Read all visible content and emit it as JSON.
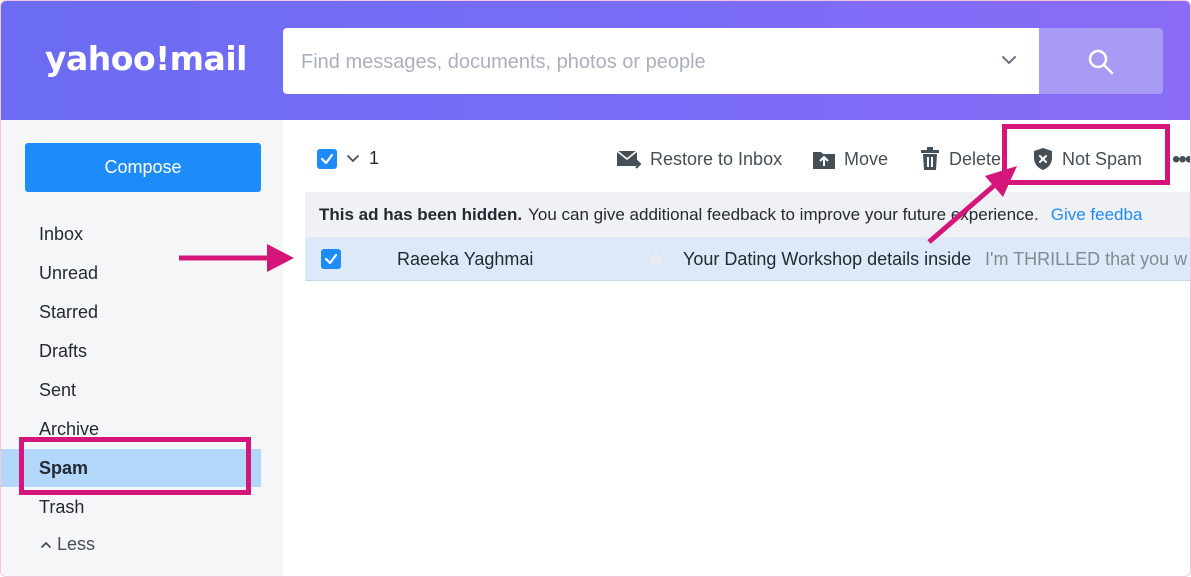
{
  "header": {
    "logo_text": "yahoo!mail",
    "search": {
      "placeholder": "Find messages, documents, photos or people",
      "value": ""
    }
  },
  "sidebar": {
    "compose_label": "Compose",
    "items": [
      {
        "label": "Inbox",
        "active": false
      },
      {
        "label": "Unread",
        "active": false
      },
      {
        "label": "Starred",
        "active": false
      },
      {
        "label": "Drafts",
        "active": false
      },
      {
        "label": "Sent",
        "active": false
      },
      {
        "label": "Archive",
        "active": false
      },
      {
        "label": "Spam",
        "active": true
      },
      {
        "label": "Trash",
        "active": false
      }
    ],
    "less_label": "Less"
  },
  "toolbar": {
    "selected_count": "1",
    "restore_label": "Restore to Inbox",
    "move_label": "Move",
    "delete_label": "Delete",
    "not_spam_label": "Not Spam",
    "more_label": "•••"
  },
  "ad_notice": {
    "strong": "This ad has been hidden.",
    "text": "You can give additional feedback to improve your future experience.",
    "link": "Give feedba"
  },
  "messages": [
    {
      "sender": "Raeeka Yaghmai",
      "subject": "Your Dating Workshop details inside",
      "preview": "I'm THRILLED that you w",
      "selected": true,
      "starred": false
    }
  ],
  "colors": {
    "accent": "#1d8cf8",
    "header_purple": "#7b6cf8",
    "annotation_pink": "#d4167a",
    "active_nav": "#b3d6fb"
  },
  "icons": [
    "search-icon",
    "chevron-down-icon",
    "restore-icon",
    "move-icon",
    "trash-icon",
    "shield-x-icon",
    "star-icon",
    "checkbox-icon",
    "chevron-up-icon",
    "more-icon"
  ]
}
